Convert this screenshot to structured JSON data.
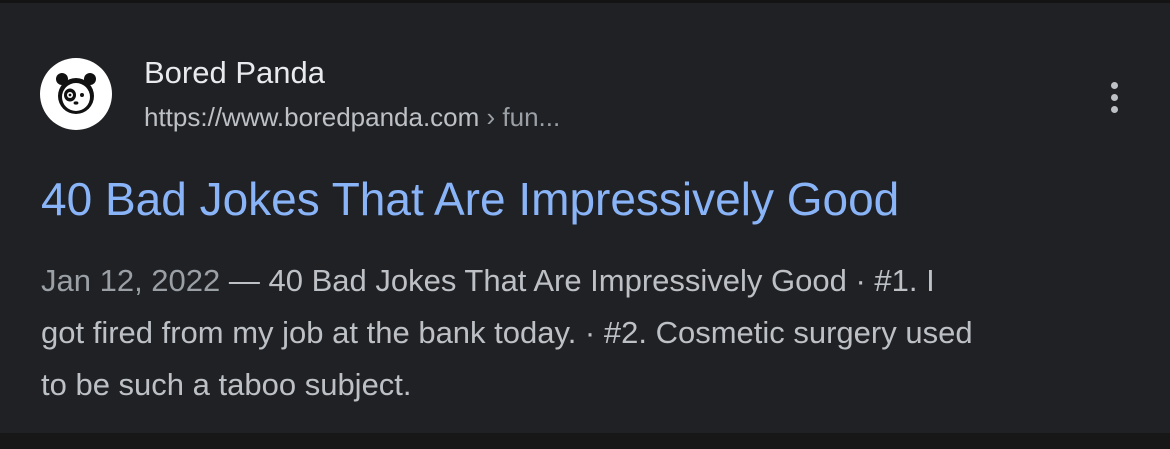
{
  "result": {
    "favicon_icon": "panda-icon",
    "site_name": "Bored Panda",
    "url": "https://www.boredpanda.com",
    "url_crumb": " › fun...",
    "more_icon": "more-vert-icon",
    "title": "40 Bad Jokes That Are Impressively Good",
    "date": "Jan 12, 2022",
    "snippet_lines": [
      " — 40 Bad Jokes That Are Impressively Good · #1. I",
      "got fired from my job at the bank today. · #2. Cosmetic surgery used",
      "to be such a taboo subject."
    ]
  },
  "colors": {
    "background": "#202124",
    "title_link": "#8ab4f8",
    "site_name": "#e8eaed",
    "snippet": "#bdc1c6"
  }
}
